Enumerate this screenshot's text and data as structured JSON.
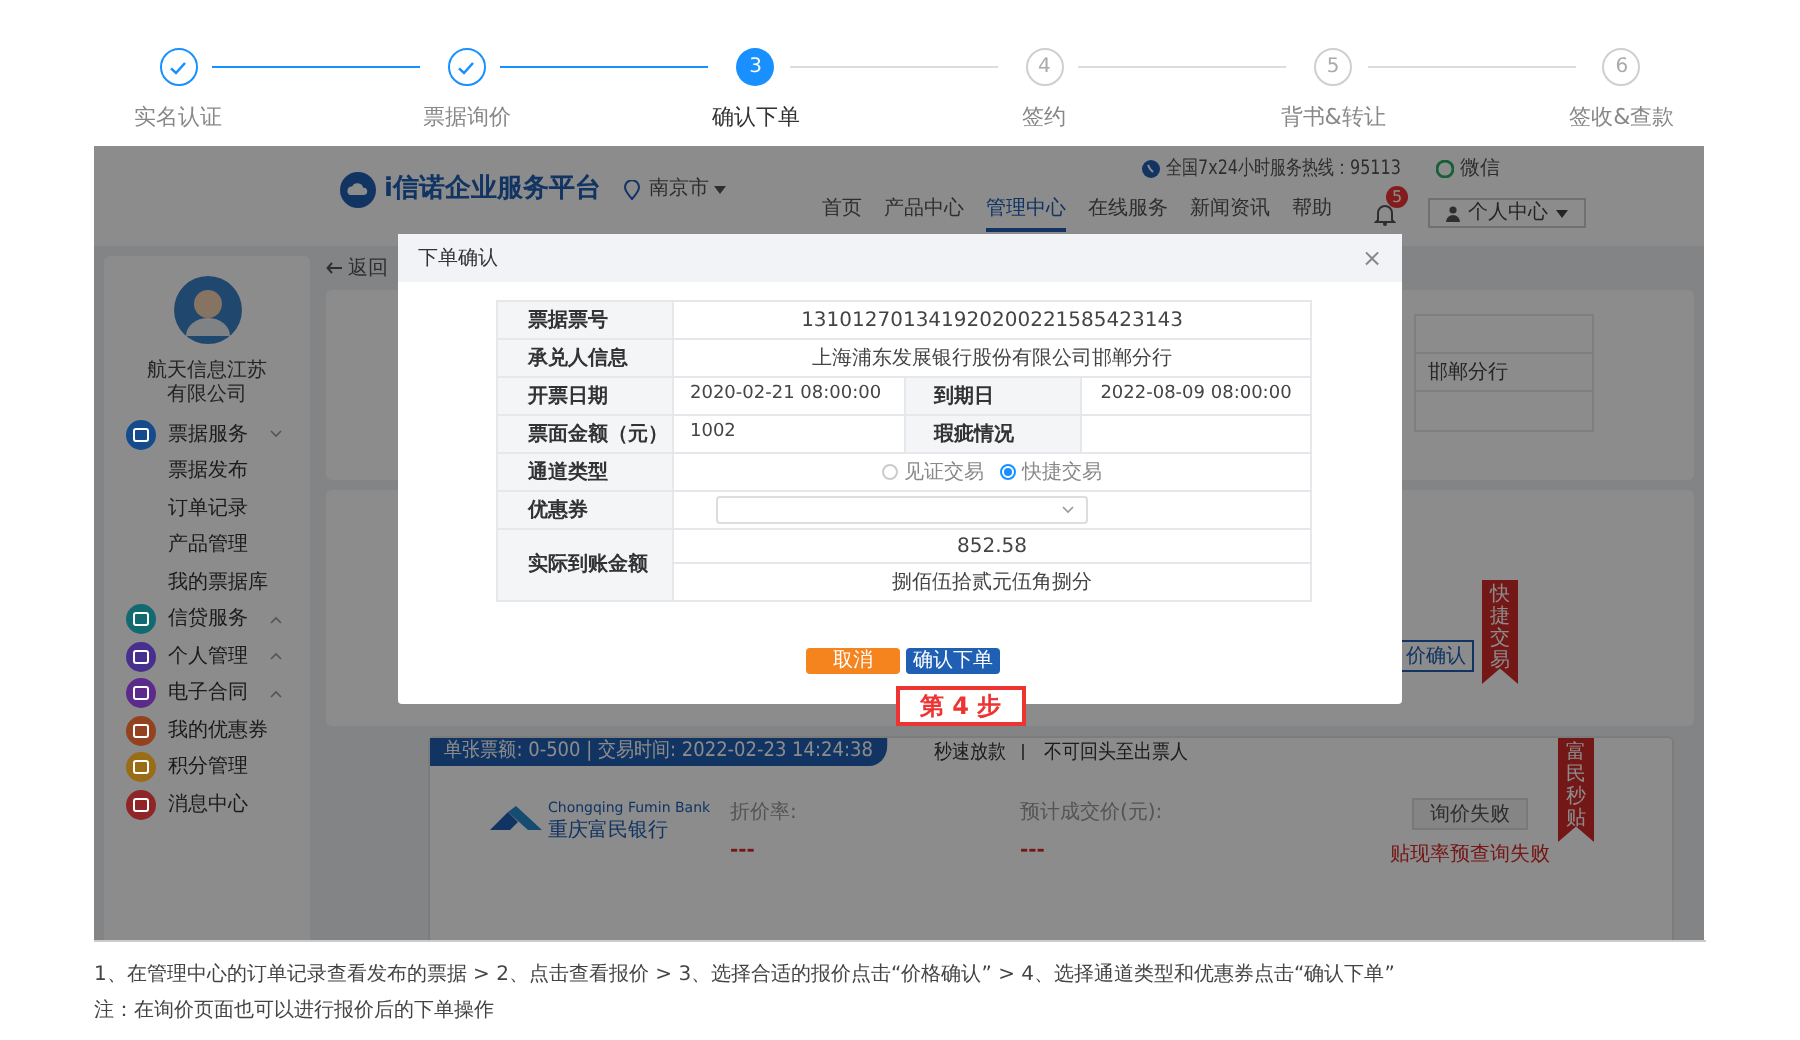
{
  "steps": [
    {
      "label": "实名认证",
      "completed": true,
      "selected": false
    },
    {
      "label": "票据询价",
      "completed": true,
      "selected": false
    },
    {
      "label": "确认下单",
      "completed": false,
      "selected": true,
      "number": "3"
    },
    {
      "label": "签约",
      "completed": false,
      "selected": false,
      "number": "4"
    },
    {
      "label": "背书&转让",
      "completed": false,
      "selected": false,
      "number": "5"
    },
    {
      "label": "签收&查款",
      "completed": false,
      "selected": false,
      "number": "6"
    }
  ],
  "screenshot": {
    "header": {
      "brand": "i信诺企业服务平台",
      "city": "南京市",
      "hotline": "全国7x24小时服务热线：95113",
      "wechat": "微信",
      "nav": [
        {
          "label": "首页",
          "selected": false
        },
        {
          "label": "产品中心",
          "selected": false
        },
        {
          "label": "管理中心",
          "selected": true
        },
        {
          "label": "在线服务",
          "selected": false
        },
        {
          "label": "新闻资讯",
          "selected": false
        },
        {
          "label": "帮助",
          "selected": false
        }
      ],
      "notification_count": "5",
      "user_menu": "个人中心"
    },
    "sidebar": {
      "company": "航天信息江苏有限公司",
      "menu": [
        {
          "label": "票据服务",
          "color": "#154a8c",
          "expanded": true,
          "children": [
            {
              "label": "票据发布"
            },
            {
              "label": "订单记录"
            },
            {
              "label": "产品管理"
            },
            {
              "label": "我的票据库"
            }
          ]
        },
        {
          "label": "信贷服务",
          "color": "#116a70",
          "expanded": false
        },
        {
          "label": "个人管理",
          "color": "#482f8e",
          "expanded": false
        },
        {
          "label": "电子合同",
          "color": "#5c2a8a",
          "expanded": false
        },
        {
          "label": "我的优惠券",
          "color": "#94411f"
        },
        {
          "label": "积分管理",
          "color": "#9a6c16"
        },
        {
          "label": "消息中心",
          "color": "#8f2527"
        }
      ]
    },
    "back_link": "返回",
    "upper_card": {
      "cell_text": "邯郸分行"
    },
    "middle_card": {
      "button": "价确认",
      "ribbon": "快捷交易"
    },
    "offer_card": {
      "tag": "单张票额: 0-500 | 交易时间: 2022-02-23 14:24:38",
      "features": [
        "秒速放款",
        "不可回头至出票人"
      ],
      "ribbon": "富民秒贴",
      "bank_name_en": "Chongqing Fumin Bank",
      "bank_name": "重庆富民银行",
      "rate_label": "折价率:",
      "rate_value": "---",
      "price_label": "预计成交价(元):",
      "price_value": "---",
      "button": "询价失败",
      "error": "贴现率预查询失败"
    },
    "dialog": {
      "title": "下单确认",
      "close": "×",
      "rows": [
        {
          "kind": "single",
          "label": "票据票号",
          "value": "131012701341920200221585423143"
        },
        {
          "kind": "single",
          "label": "承兑人信息",
          "value": "上海浦东发展银行股份有限公司邯郸分行"
        },
        {
          "kind": "pair",
          "label": "开票日期",
          "value": "2020-02-21 08:00:00",
          "label_2": "到期日",
          "value_2": "2022-08-09 08:00:00"
        },
        {
          "kind": "pair",
          "label": "票面金额（元）",
          "value": "1002",
          "label_2": "瑕疵情况"
        },
        {
          "kind": "radio",
          "label": "通道类型",
          "options": [
            {
              "label": "见证交易",
              "selected": false
            },
            {
              "label": "快捷交易",
              "selected": true
            }
          ]
        },
        {
          "kind": "select",
          "label": "优惠券"
        },
        {
          "kind": "amount",
          "label": "实际到账金额",
          "value": "852.58",
          "value_2": "捌佰伍拾贰元伍角捌分"
        }
      ],
      "cancel": "取消",
      "confirm": "确认下单"
    },
    "callout": "第 4 步"
  },
  "notes": [
    "1、在管理中心的订单记录查看发布的票据 > 2、点击查看报价 > 3、选择合适的报价点击“价格确认” > 4、选择通道类型和优惠券点击“确认下单”",
    "注：在询价页面也可以进行报价后的下单操作"
  ]
}
